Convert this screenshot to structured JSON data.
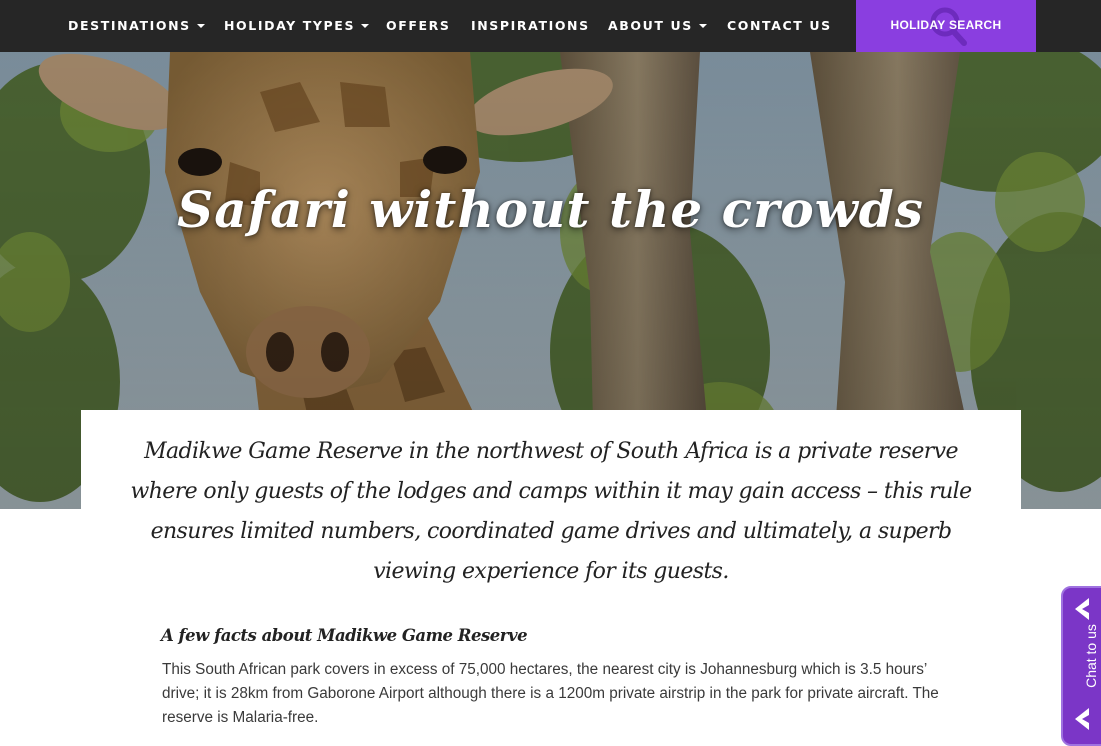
{
  "nav": {
    "items": [
      {
        "label": "DESTINATIONS",
        "dropdown": true
      },
      {
        "label": "HOLIDAY TYPES",
        "dropdown": true
      },
      {
        "label": "OFFERS",
        "dropdown": false
      },
      {
        "label": "INSPIRATIONS",
        "dropdown": false
      },
      {
        "label": "ABOUT US",
        "dropdown": true
      },
      {
        "label": "CONTACT US",
        "dropdown": false
      }
    ],
    "search_button_label": "HOLIDAY SEARCH",
    "search_icon": "search-icon"
  },
  "hero": {
    "title": "Safari without the crowds",
    "image": "giraffe-in-trees"
  },
  "intro": {
    "text": "Madikwe Game Reserve in the northwest of South Africa is a private reserve where only guests of the lodges and camps within it may gain access – this rule ensures limited numbers, coordinated game drives and ultimately, a superb viewing experience for its guests."
  },
  "facts": {
    "heading": "A few facts about Madikwe Game Reserve",
    "body": "This South African park covers in excess of 75,000 hectares, the nearest city is Johannesburg which is 3.5 hours’ drive; it is 28km from Gaborone Airport although there is a 1200m private airstrip in the park for private aircraft. The reserve is Malaria-free."
  },
  "chat": {
    "label": "Chat to us",
    "icon": "chevron-left-icon"
  },
  "colors": {
    "nav_background": "#262626",
    "accent_purple": "#8a3ee0",
    "chat_purple": "#7b36c7",
    "text_dark": "#222222"
  }
}
